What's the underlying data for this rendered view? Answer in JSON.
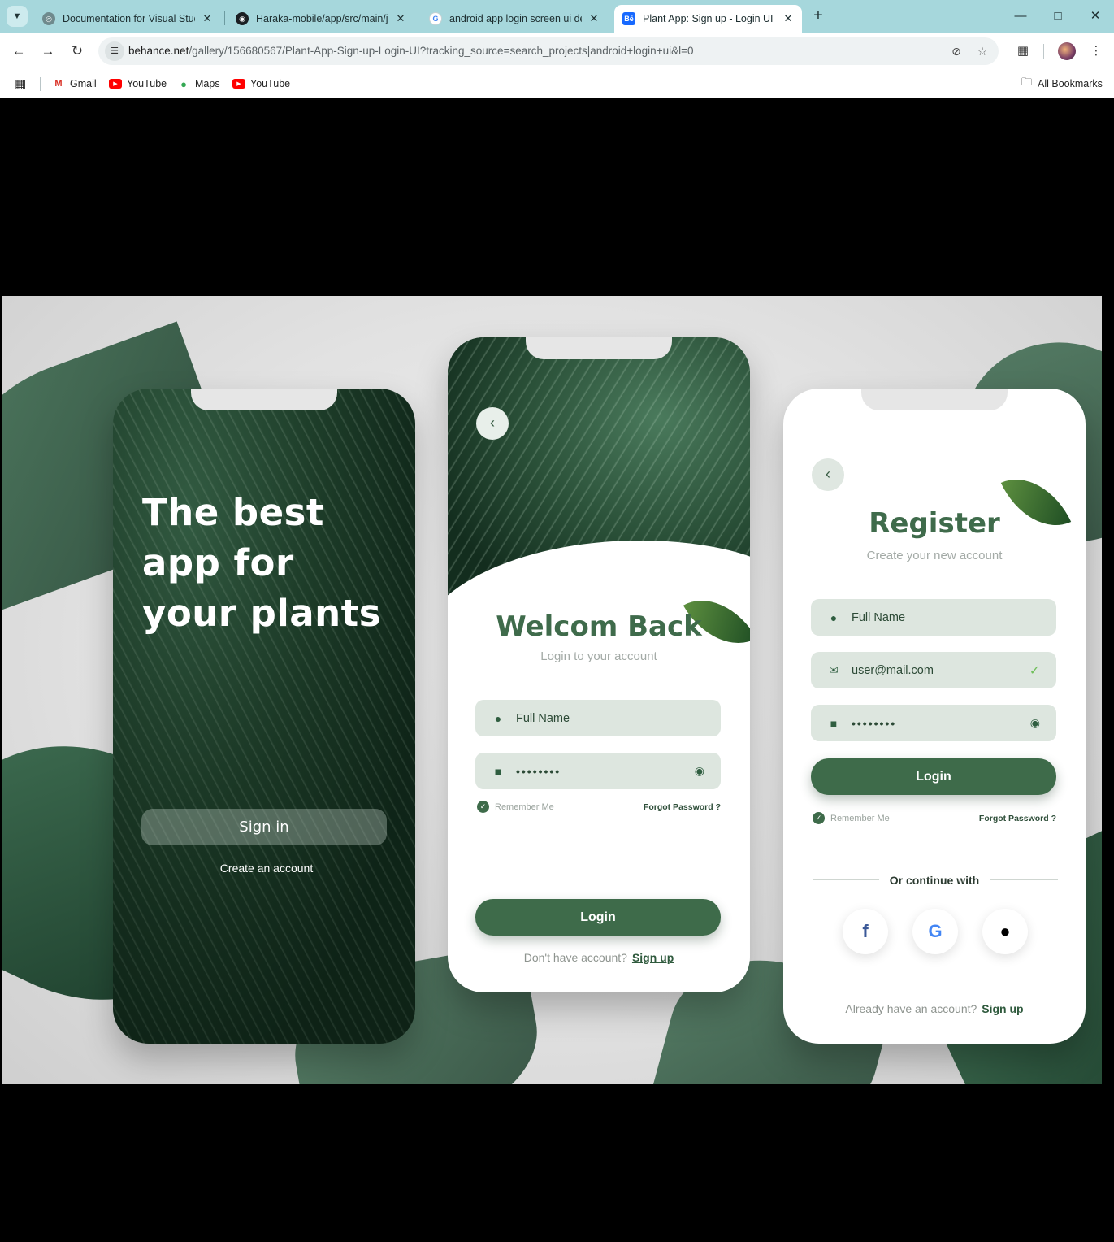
{
  "browser": {
    "tabs": [
      {
        "title": "Documentation for Visual Studi",
        "favicon": "globe-icon"
      },
      {
        "title": "Haraka-mobile/app/src/main/ja",
        "favicon": "github-icon"
      },
      {
        "title": "android app login screen ui des",
        "favicon": "google-icon"
      },
      {
        "title": "Plant App: Sign up - Login UI ::",
        "favicon": "behance-icon",
        "active": true
      }
    ],
    "new_tab": "+",
    "url_domain": "behance.net",
    "url_path": "/gallery/156680567/Plant-App-Sign-up-Login-UI?tracking_source=search_projects|android+login+ui&l=0",
    "bookmarks": [
      {
        "label": "Gmail",
        "icon": "gmail-icon"
      },
      {
        "label": "YouTube",
        "icon": "youtube-icon"
      },
      {
        "label": "Maps",
        "icon": "maps-icon"
      },
      {
        "label": "YouTube",
        "icon": "youtube-icon"
      }
    ],
    "all_bookmarks": "All Bookmarks"
  },
  "phone1": {
    "headline": [
      "The best",
      "app for",
      "your plants"
    ],
    "signin_label": "Sign in",
    "create_label": "Create an account"
  },
  "phone2": {
    "title": "Welcom Back",
    "subtitle": "Login to your account",
    "name_placeholder": "Full Name",
    "password_mask": "••••••••",
    "remember": "Remember Me",
    "forgot": "Forgot Password ?",
    "login": "Login",
    "footer_text": "Don't have account?",
    "footer_link": "Sign up"
  },
  "phone3": {
    "title": "Register",
    "subtitle": "Create your new account",
    "name_placeholder": "Full Name",
    "email_value": "user@mail.com",
    "password_mask": "••••••••",
    "login": "Login",
    "remember": "Remember Me",
    "forgot": "Forgot Password ?",
    "or_continue": "Or continue with",
    "footer_text": "Already have an account?",
    "footer_link": "Sign up"
  },
  "colors": {
    "brand_green": "#3e6b4a",
    "field_bg": "#dde6df",
    "chrome_bg": "#a6d7dc"
  }
}
